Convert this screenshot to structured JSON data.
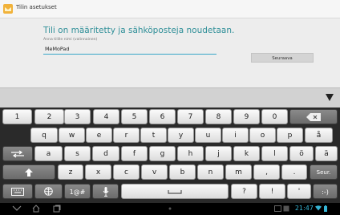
{
  "titlebar": {
    "title": "Tilin asetukset"
  },
  "content": {
    "heading": "Tili on määritetty ja sähköposteja noudetaan.",
    "name_label": "Anna tilille nimi (valinnainen)",
    "name_value": "MeMoPad",
    "next_label": "Seuraava"
  },
  "keyboard": {
    "row1": [
      "1",
      "2",
      "3",
      "4",
      "5",
      "6",
      "7",
      "8",
      "9",
      "0"
    ],
    "row2": [
      "q",
      "w",
      "e",
      "r",
      "t",
      "y",
      "u",
      "i",
      "o",
      "p",
      "å"
    ],
    "row3": [
      "a",
      "s",
      "d",
      "f",
      "g",
      "h",
      "j",
      "k",
      "l",
      "ö",
      "ä"
    ],
    "row4": [
      "z",
      "x",
      "c",
      "v",
      "b",
      "n",
      "m",
      ",",
      "."
    ],
    "row4_action": "Seur.",
    "row5_symbols": "1@#",
    "row5_question": "?",
    "row5_excl": "!",
    "row5_quote": "'",
    "row5_smiley": ":-)"
  },
  "status": {
    "time": "21:47"
  },
  "icons": [
    "account-icon",
    "hide-keyboard-icon",
    "backspace-icon",
    "tab-icon",
    "shift-icon",
    "keyboard-settings-icon",
    "globe-icon",
    "microphone-icon",
    "space-icon",
    "back-icon",
    "home-icon",
    "recent-apps-icon",
    "wifi-icon",
    "battery-icon"
  ]
}
